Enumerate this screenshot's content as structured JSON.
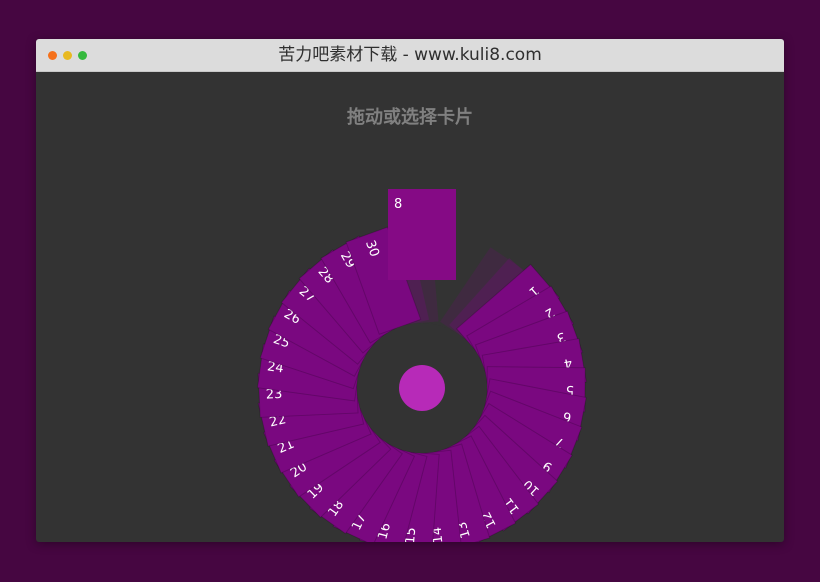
{
  "window": {
    "title": "苦力吧素材下载 - www.kuli8.com",
    "controls": {
      "close_color": "#f5711b",
      "minimize_color": "#e8b921",
      "maximize_color": "#35b93e"
    }
  },
  "main": {
    "heading": "拖动或选择卡片"
  },
  "colors": {
    "page_background": "#460641",
    "window_background": "#333333",
    "card": "#7a0880",
    "selected_card": "#850a85",
    "center_button": "#b72ab8"
  },
  "cards": {
    "labels": [
      "1",
      "2",
      "3",
      "4",
      "5",
      "6",
      "7",
      "9",
      "10",
      "11",
      "12",
      "13",
      "14",
      "15",
      "16",
      "17",
      "18",
      "19",
      "20",
      "21",
      "22",
      "23",
      "24",
      "25",
      "26",
      "27",
      "28",
      "29",
      "30"
    ],
    "selected": "8"
  }
}
